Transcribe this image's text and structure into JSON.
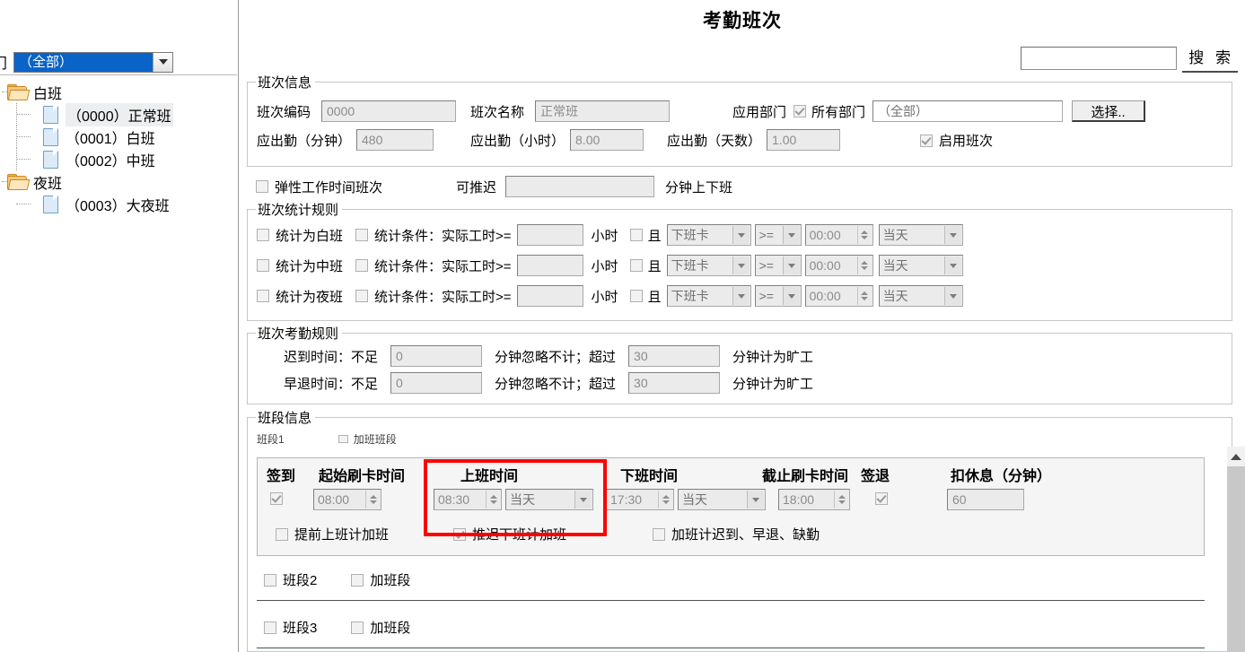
{
  "page": {
    "title": "考勤班次"
  },
  "search": {
    "value": "",
    "button_label": "搜 索"
  },
  "department_filter": {
    "label": "部门",
    "value": "（全部）"
  },
  "tree": {
    "nodes": [
      {
        "type": "folder",
        "label": "白班"
      },
      {
        "type": "leaf",
        "label": "（0000）正常班",
        "selected": true
      },
      {
        "type": "leaf",
        "label": "（0001）白班",
        "selected": false
      },
      {
        "type": "leaf",
        "label": "（0002）中班",
        "selected": false
      },
      {
        "type": "folder",
        "label": "夜班"
      },
      {
        "type": "leaf",
        "label": "（0003）大夜班",
        "selected": false
      }
    ]
  },
  "shift_info": {
    "legend": "班次信息",
    "code_label": "班次编码",
    "code_value": "0000",
    "name_label": "班次名称",
    "name_value": "正常班",
    "dept_label": "应用部门",
    "all_dept_label": "所有部门",
    "all_dept_checked": true,
    "dept_value": "（全部）",
    "choose_button": "选择..",
    "minutes_label": "应出勤（分钟）",
    "minutes_value": "480",
    "hours_label": "应出勤（小时）",
    "hours_value": "8.00",
    "days_label": "应出勤（天数）",
    "days_value": "1.00",
    "enable_label": "启用班次",
    "enable_checked": true
  },
  "flex_row": {
    "flex_shift_label": "弹性工作时间班次",
    "flex_shift_checked": false,
    "delay_label": "可推迟",
    "delay_value": "",
    "delay_suffix": "分钟上下班"
  },
  "stat_rules": {
    "legend": "班次统计规则",
    "unit_label": "小时",
    "and_label": "且",
    "rows": [
      {
        "stat_label": "统计为白班",
        "stat_checked": false,
        "cond_label": "统计条件：实际工时>=",
        "cond_checked": false,
        "hours_value": "",
        "and_checked": false,
        "card_type": "下班卡",
        "operator": ">=",
        "time_value": "00:00",
        "day_value": "当天"
      },
      {
        "stat_label": "统计为中班",
        "stat_checked": false,
        "cond_label": "统计条件：实际工时>=",
        "cond_checked": false,
        "hours_value": "",
        "and_checked": false,
        "card_type": "下班卡",
        "operator": ">=",
        "time_value": "00:00",
        "day_value": "当天"
      },
      {
        "stat_label": "统计为夜班",
        "stat_checked": false,
        "cond_label": "统计条件：实际工时>=",
        "cond_checked": false,
        "hours_value": "",
        "and_checked": false,
        "card_type": "下班卡",
        "operator": ">=",
        "time_value": "00:00",
        "day_value": "当天"
      }
    ]
  },
  "att_rules": {
    "legend": "班次考勤规则",
    "rows": [
      {
        "label": "迟到时间：不足",
        "ignore_value": "0",
        "mid_label": "分钟忽略不计；超过",
        "absent_value": "30",
        "suffix_label": "分钟计为旷工"
      },
      {
        "label": "早退时间：不足",
        "ignore_value": "0",
        "mid_label": "分钟忽略不计；超过",
        "absent_value": "30",
        "suffix_label": "分钟计为旷工"
      }
    ]
  },
  "segment_info": {
    "legend": "班段信息",
    "ghost_row": {
      "segment_label": "班段1",
      "overtime_label": "加班班段",
      "overtime_checked": false
    },
    "headers": {
      "signin": "签到",
      "start_card": "起始刷卡时间",
      "work_start": "上班时间",
      "work_end": "下班时间",
      "end_card": "截止刷卡时间",
      "signout": "签退",
      "break_deduct": "扣休息（分钟）"
    },
    "row1": {
      "signin_checked": true,
      "start_card_time": "08:00",
      "work_start_time": "08:30",
      "work_start_day": "当天",
      "work_end_time": "17:30",
      "work_end_day": "当天",
      "end_card_time": "18:00",
      "signout_checked": true,
      "break_deduct_value": "60"
    },
    "options": [
      {
        "label": "提前上班计加班",
        "checked": false
      },
      {
        "label": "推迟下班计加班",
        "checked": true
      },
      {
        "label": "加班计迟到、早退、缺勤",
        "checked": false
      }
    ],
    "segment2": {
      "label": "班段2",
      "checked": false,
      "overtime_label": "加班段",
      "overtime_checked": false
    },
    "segment3": {
      "label": "班段3",
      "checked": false,
      "overtime_label": "加班段",
      "overtime_checked": false
    }
  },
  "colors": {
    "highlight_box": "#ff0000",
    "selection_blue": "#0a64c8"
  }
}
